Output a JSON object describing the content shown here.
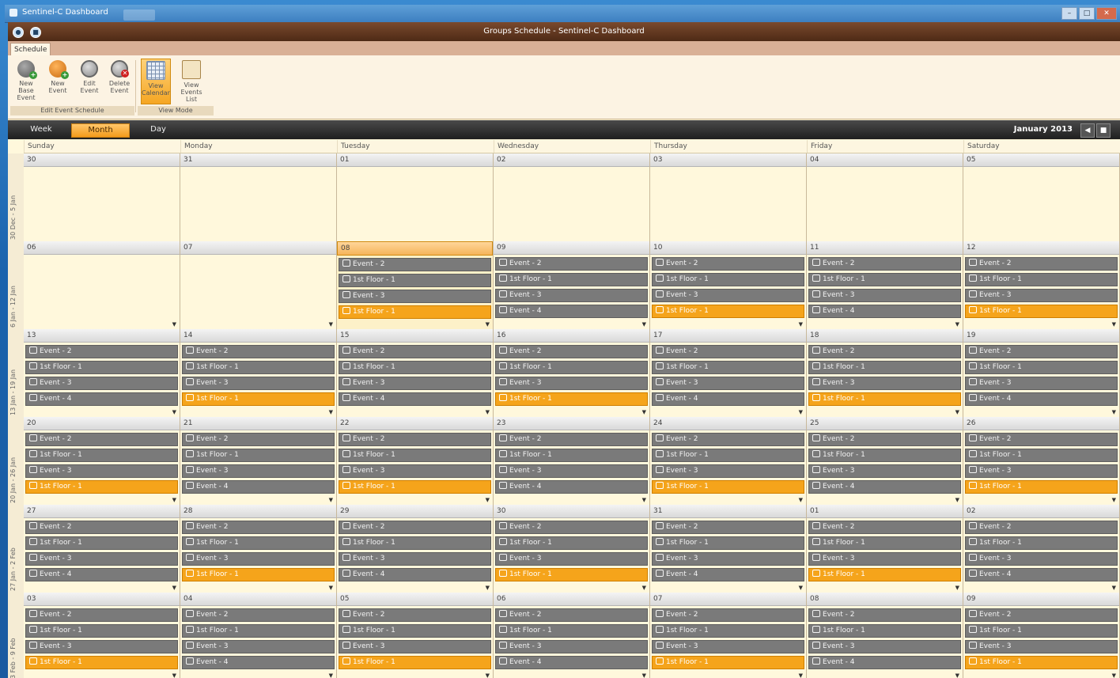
{
  "os_window": {
    "title": "Sentinel-C Dashboard"
  },
  "app": {
    "title": "Groups Schedule - Sentinel-C Dashboard"
  },
  "ribbon": {
    "tab": "Schedule",
    "groups": [
      {
        "label": "Edit Event Schedule",
        "buttons": [
          {
            "label": "New\nBase Event",
            "icon": "new-base-event-icon"
          },
          {
            "label": "New\nEvent",
            "icon": "new-event-icon"
          },
          {
            "label": "Edit\nEvent",
            "icon": "edit-event-icon"
          },
          {
            "label": "Delete\nEvent",
            "icon": "delete-event-icon"
          }
        ]
      },
      {
        "label": "View Mode",
        "buttons": [
          {
            "label": "View\nCalendar",
            "icon": "calendar-icon",
            "active": true
          },
          {
            "label": "View\nEvents List",
            "icon": "events-list-icon"
          }
        ]
      }
    ]
  },
  "viewbar": {
    "tabs": [
      "Week",
      "Month",
      "Day"
    ],
    "active_tab": "Month",
    "month_label": "January 2013"
  },
  "calendar": {
    "day_names": [
      "Sunday",
      "Monday",
      "Tuesday",
      "Wednesday",
      "Thursday",
      "Friday",
      "Saturday"
    ],
    "weeks": [
      {
        "label": "30 Dec - 5 Jan",
        "days": [
          {
            "date": "30",
            "events": []
          },
          {
            "date": "31",
            "events": []
          },
          {
            "date": "01",
            "events": []
          },
          {
            "date": "02",
            "events": []
          },
          {
            "date": "03",
            "events": []
          },
          {
            "date": "04",
            "events": []
          },
          {
            "date": "05",
            "events": []
          }
        ]
      },
      {
        "label": "6 Jan - 12 Jan",
        "days": [
          {
            "date": "06",
            "events": []
          },
          {
            "date": "07",
            "events": []
          },
          {
            "date": "08",
            "today": true,
            "events": [
              {
                "t": "Event - 2"
              },
              {
                "t": "1st Floor - 1"
              },
              {
                "t": "Event - 3"
              },
              {
                "t": "1st Floor - 1",
                "o": true
              }
            ]
          },
          {
            "date": "09",
            "events": [
              {
                "t": "Event - 2"
              },
              {
                "t": "1st Floor - 1"
              },
              {
                "t": "Event - 3"
              },
              {
                "t": "Event - 4"
              }
            ]
          },
          {
            "date": "10",
            "events": [
              {
                "t": "Event - 2"
              },
              {
                "t": "1st Floor - 1"
              },
              {
                "t": "Event - 3"
              },
              {
                "t": "1st Floor - 1",
                "o": true
              }
            ]
          },
          {
            "date": "11",
            "events": [
              {
                "t": "Event - 2"
              },
              {
                "t": "1st Floor - 1"
              },
              {
                "t": "Event - 3"
              },
              {
                "t": "Event - 4"
              }
            ]
          },
          {
            "date": "12",
            "events": [
              {
                "t": "Event - 2"
              },
              {
                "t": "1st Floor - 1"
              },
              {
                "t": "Event - 3"
              },
              {
                "t": "1st Floor - 1",
                "o": true
              }
            ]
          }
        ]
      },
      {
        "label": "13 Jan - 19 Jan",
        "days": [
          {
            "date": "13",
            "events": [
              {
                "t": "Event - 2"
              },
              {
                "t": "1st Floor - 1"
              },
              {
                "t": "Event - 3"
              },
              {
                "t": "Event - 4"
              }
            ]
          },
          {
            "date": "14",
            "events": [
              {
                "t": "Event - 2"
              },
              {
                "t": "1st Floor - 1"
              },
              {
                "t": "Event - 3"
              },
              {
                "t": "1st Floor - 1",
                "o": true
              }
            ]
          },
          {
            "date": "15",
            "events": [
              {
                "t": "Event - 2"
              },
              {
                "t": "1st Floor - 1"
              },
              {
                "t": "Event - 3"
              },
              {
                "t": "Event - 4"
              }
            ]
          },
          {
            "date": "16",
            "events": [
              {
                "t": "Event - 2"
              },
              {
                "t": "1st Floor - 1"
              },
              {
                "t": "Event - 3"
              },
              {
                "t": "1st Floor - 1",
                "o": true
              }
            ]
          },
          {
            "date": "17",
            "events": [
              {
                "t": "Event - 2"
              },
              {
                "t": "1st Floor - 1"
              },
              {
                "t": "Event - 3"
              },
              {
                "t": "Event - 4"
              }
            ]
          },
          {
            "date": "18",
            "events": [
              {
                "t": "Event - 2"
              },
              {
                "t": "1st Floor - 1"
              },
              {
                "t": "Event - 3"
              },
              {
                "t": "1st Floor - 1",
                "o": true
              }
            ]
          },
          {
            "date": "19",
            "events": [
              {
                "t": "Event - 2"
              },
              {
                "t": "1st Floor - 1"
              },
              {
                "t": "Event - 3"
              },
              {
                "t": "Event - 4"
              }
            ]
          }
        ]
      },
      {
        "label": "20 Jan - 26 Jan",
        "days": [
          {
            "date": "20",
            "events": [
              {
                "t": "Event - 2"
              },
              {
                "t": "1st Floor - 1"
              },
              {
                "t": "Event - 3"
              },
              {
                "t": "1st Floor - 1",
                "o": true
              }
            ]
          },
          {
            "date": "21",
            "events": [
              {
                "t": "Event - 2"
              },
              {
                "t": "1st Floor - 1"
              },
              {
                "t": "Event - 3"
              },
              {
                "t": "Event - 4"
              }
            ]
          },
          {
            "date": "22",
            "events": [
              {
                "t": "Event - 2"
              },
              {
                "t": "1st Floor - 1"
              },
              {
                "t": "Event - 3"
              },
              {
                "t": "1st Floor - 1",
                "o": true
              }
            ]
          },
          {
            "date": "23",
            "events": [
              {
                "t": "Event - 2"
              },
              {
                "t": "1st Floor - 1"
              },
              {
                "t": "Event - 3"
              },
              {
                "t": "Event - 4"
              }
            ]
          },
          {
            "date": "24",
            "events": [
              {
                "t": "Event - 2"
              },
              {
                "t": "1st Floor - 1"
              },
              {
                "t": "Event - 3"
              },
              {
                "t": "1st Floor - 1",
                "o": true
              }
            ]
          },
          {
            "date": "25",
            "events": [
              {
                "t": "Event - 2"
              },
              {
                "t": "1st Floor - 1"
              },
              {
                "t": "Event - 3"
              },
              {
                "t": "Event - 4"
              }
            ]
          },
          {
            "date": "26",
            "events": [
              {
                "t": "Event - 2"
              },
              {
                "t": "1st Floor - 1"
              },
              {
                "t": "Event - 3"
              },
              {
                "t": "1st Floor - 1",
                "o": true
              }
            ]
          }
        ]
      },
      {
        "label": "27 Jan - 2 Feb",
        "days": [
          {
            "date": "27",
            "events": [
              {
                "t": "Event - 2"
              },
              {
                "t": "1st Floor - 1"
              },
              {
                "t": "Event - 3"
              },
              {
                "t": "Event - 4"
              }
            ]
          },
          {
            "date": "28",
            "events": [
              {
                "t": "Event - 2"
              },
              {
                "t": "1st Floor - 1"
              },
              {
                "t": "Event - 3"
              },
              {
                "t": "1st Floor - 1",
                "o": true
              }
            ]
          },
          {
            "date": "29",
            "events": [
              {
                "t": "Event - 2"
              },
              {
                "t": "1st Floor - 1"
              },
              {
                "t": "Event - 3"
              },
              {
                "t": "Event - 4"
              }
            ]
          },
          {
            "date": "30",
            "events": [
              {
                "t": "Event - 2"
              },
              {
                "t": "1st Floor - 1"
              },
              {
                "t": "Event - 3"
              },
              {
                "t": "1st Floor - 1",
                "o": true
              }
            ]
          },
          {
            "date": "31",
            "events": [
              {
                "t": "Event - 2"
              },
              {
                "t": "1st Floor - 1"
              },
              {
                "t": "Event - 3"
              },
              {
                "t": "Event - 4"
              }
            ]
          },
          {
            "date": "01",
            "events": [
              {
                "t": "Event - 2"
              },
              {
                "t": "1st Floor - 1"
              },
              {
                "t": "Event - 3"
              },
              {
                "t": "1st Floor - 1",
                "o": true
              }
            ]
          },
          {
            "date": "02",
            "events": [
              {
                "t": "Event - 2"
              },
              {
                "t": "1st Floor - 1"
              },
              {
                "t": "Event - 3"
              },
              {
                "t": "Event - 4"
              }
            ]
          }
        ]
      },
      {
        "label": "3 Feb - 9 Feb",
        "days": [
          {
            "date": "03",
            "events": [
              {
                "t": "Event - 2"
              },
              {
                "t": "1st Floor - 1"
              },
              {
                "t": "Event - 3"
              },
              {
                "t": "1st Floor - 1",
                "o": true
              }
            ]
          },
          {
            "date": "04",
            "events": [
              {
                "t": "Event - 2"
              },
              {
                "t": "1st Floor - 1"
              },
              {
                "t": "Event - 3"
              },
              {
                "t": "Event - 4"
              }
            ]
          },
          {
            "date": "05",
            "events": [
              {
                "t": "Event - 2"
              },
              {
                "t": "1st Floor - 1"
              },
              {
                "t": "Event - 3"
              },
              {
                "t": "1st Floor - 1",
                "o": true
              }
            ]
          },
          {
            "date": "06",
            "events": [
              {
                "t": "Event - 2"
              },
              {
                "t": "1st Floor - 1"
              },
              {
                "t": "Event - 3"
              },
              {
                "t": "Event - 4"
              }
            ]
          },
          {
            "date": "07",
            "events": [
              {
                "t": "Event - 2"
              },
              {
                "t": "1st Floor - 1"
              },
              {
                "t": "Event - 3"
              },
              {
                "t": "1st Floor - 1",
                "o": true
              }
            ]
          },
          {
            "date": "08",
            "events": [
              {
                "t": "Event - 2"
              },
              {
                "t": "1st Floor - 1"
              },
              {
                "t": "Event - 3"
              },
              {
                "t": "Event - 4"
              }
            ]
          },
          {
            "date": "09",
            "events": [
              {
                "t": "Event - 2"
              },
              {
                "t": "1st Floor - 1"
              },
              {
                "t": "Event - 3"
              },
              {
                "t": "1st Floor - 1",
                "o": true
              }
            ]
          }
        ]
      }
    ]
  },
  "colors": {
    "event_gray": "#7a7a7a",
    "event_orange": "#f5a41b",
    "accent": "#f39b1c",
    "title_brown": "#5a321c"
  }
}
